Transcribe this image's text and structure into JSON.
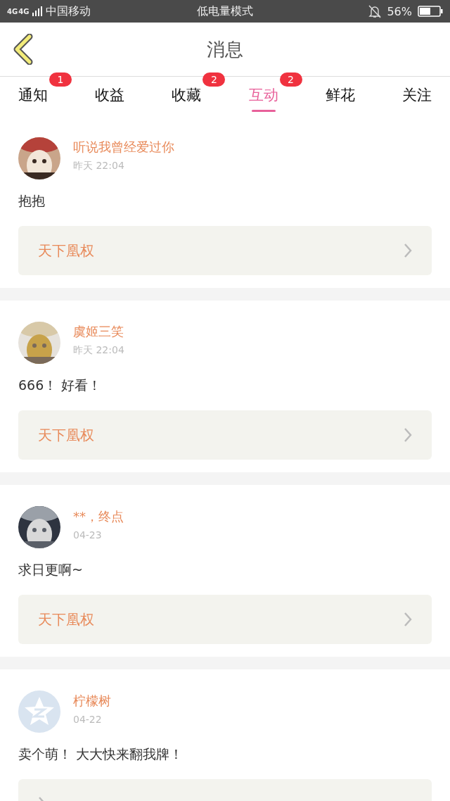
{
  "status_bar": {
    "network_1": "4G",
    "network_2": "4G",
    "carrier": "中国移动",
    "mode": "低电量模式",
    "battery": "56%"
  },
  "header": {
    "title": "消息"
  },
  "tabs": [
    {
      "label": "通知",
      "selected": false,
      "badge": "1"
    },
    {
      "label": "收益",
      "selected": false
    },
    {
      "label": "收藏",
      "selected": false,
      "badge": "2"
    },
    {
      "label": "互动",
      "selected": true,
      "badge": "2"
    },
    {
      "label": "鲜花",
      "selected": false
    },
    {
      "label": "关注",
      "selected": false
    }
  ],
  "messages": [
    {
      "name": "听说我曾经爱过你",
      "time": "昨天 22:04",
      "text": "抱抱",
      "link": "天下凰权"
    },
    {
      "name": "虞姬三笑",
      "time": "昨天 22:04",
      "text": "666！ 好看！",
      "link": "天下凰权"
    },
    {
      "name": "**，终点",
      "time": "04-23",
      "text": "求日更啊~",
      "link": "天下凰权"
    },
    {
      "avatar": {
        "kind": "default"
      },
      "name": "柠檬树",
      "time": "04-22",
      "text": "卖个萌！ 大大快来翻我牌！"
    }
  ]
}
